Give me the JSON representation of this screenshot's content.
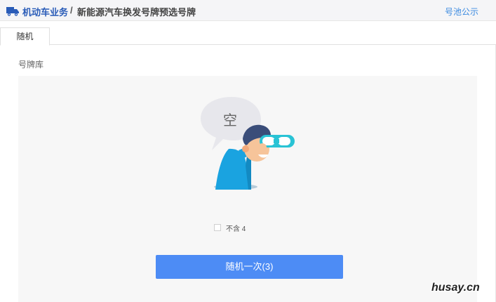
{
  "header": {
    "breadcrumb_main": "机动车业务",
    "breadcrumb_sep": "/",
    "breadcrumb_page": "新能源汽车换发号牌预选号牌",
    "pool_link": "号池公示"
  },
  "tabs": [
    {
      "label": "随机"
    }
  ],
  "main": {
    "section_label": "号牌库",
    "empty_text": "空",
    "checkbox_label": "不含 4",
    "checkbox_checked": false,
    "random_button_label": "随机一次(3)"
  },
  "watermark": "husay.cn",
  "icons": {
    "truck": "truck-icon",
    "empty_illustration": "binoculars-person-illustration"
  },
  "colors": {
    "accent_blue": "#2a5cb8",
    "link_blue": "#3b8ae0",
    "button_blue": "#4d8cf5",
    "illus_blue": "#1aa3e0",
    "teal": "#29c3d5"
  }
}
